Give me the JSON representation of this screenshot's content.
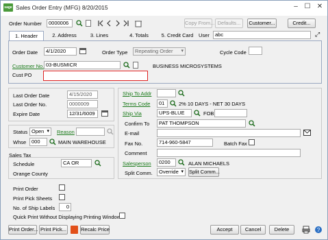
{
  "window": {
    "logo_text": "sage",
    "title": "Sales Order Entry (MFG) 8/20/2015",
    "min": "–",
    "max": "☐",
    "close": "✕"
  },
  "toolbar": {
    "order_number_label": "Order Number",
    "order_number_value": "0000006",
    "copy_from": "Copy From...",
    "defaults": "Defaults...",
    "customer": "Customer...",
    "credit": "Credit..."
  },
  "tabs": [
    {
      "label": "1. Header"
    },
    {
      "label": "2. Address"
    },
    {
      "label": "3. Lines"
    },
    {
      "label": "4. Totals"
    },
    {
      "label": "5. Credit Card"
    }
  ],
  "user": {
    "label": "User",
    "value": "abc"
  },
  "header": {
    "order_date_label": "Order Date",
    "order_date": "4/1/2020",
    "order_type_label": "Order Type",
    "order_type": "Repeating Order",
    "cycle_code_label": "Cycle Code",
    "cycle_code": "",
    "customer_no_label": "Customer No.",
    "customer_no": "03-BUSMICR",
    "customer_name": "BUSINESS MICROSYSTEMS",
    "cust_po_label": "Cust PO",
    "cust_po": ""
  },
  "left_panel": {
    "last_order_date_label": "Last Order Date",
    "last_order_date": "4/15/2020",
    "last_order_no_label": "Last Order No.",
    "last_order_no": "0000009",
    "expire_date_label": "Expire Date",
    "expire_date": "12/31/6009"
  },
  "status": {
    "status_label": "Status",
    "status_value": "Open",
    "reason_label": "Reason",
    "whse_label": "Whse",
    "whse_value": "000",
    "whse_name": "MAIN WAREHOUSE"
  },
  "tax": {
    "section_label": "Sales Tax",
    "schedule_label": "Schedule",
    "schedule_value": "CA OR",
    "schedule_desc": "Orange County"
  },
  "right_panel": {
    "ship_to_label": "Ship To Addr",
    "ship_to": "",
    "terms_label": "Terms Code",
    "terms_code": "01",
    "terms_desc": "2% 10 DAYS - NET 30 DAYS",
    "ship_via_label": "Ship Via",
    "ship_via": "UPS-BLUE",
    "fob_label": "FOB",
    "fob": "",
    "confirm_to_label": "Confirm To",
    "confirm_to": "PAT THOMPSON",
    "email_label": "E-mail",
    "email": "",
    "fax_label": "Fax No.",
    "fax": "714-960-5847",
    "batch_fax_label": "Batch Fax",
    "comment_label": "Comment",
    "comment": "",
    "salesperson_label": "Salesperson",
    "salesperson_code": "0200",
    "salesperson_name": "ALAN MICHAELS",
    "split_comm_label": "Split Comm.",
    "split_comm_value": "Override",
    "split_comm_button": "Split Comm..."
  },
  "print_opts": {
    "print_order": "Print Order",
    "print_pick": "Print Pick Sheets",
    "labels": "No. of Ship Labels",
    "labels_value": "0",
    "quick_print": "Quick Print Without Displaying Printing Window"
  },
  "bottom": {
    "print_order": "Print Order...",
    "print_pick": "Print Pick...",
    "recalc": "Recalc Price",
    "accept": "Accept",
    "cancel": "Cancel",
    "delete": "Delete"
  }
}
